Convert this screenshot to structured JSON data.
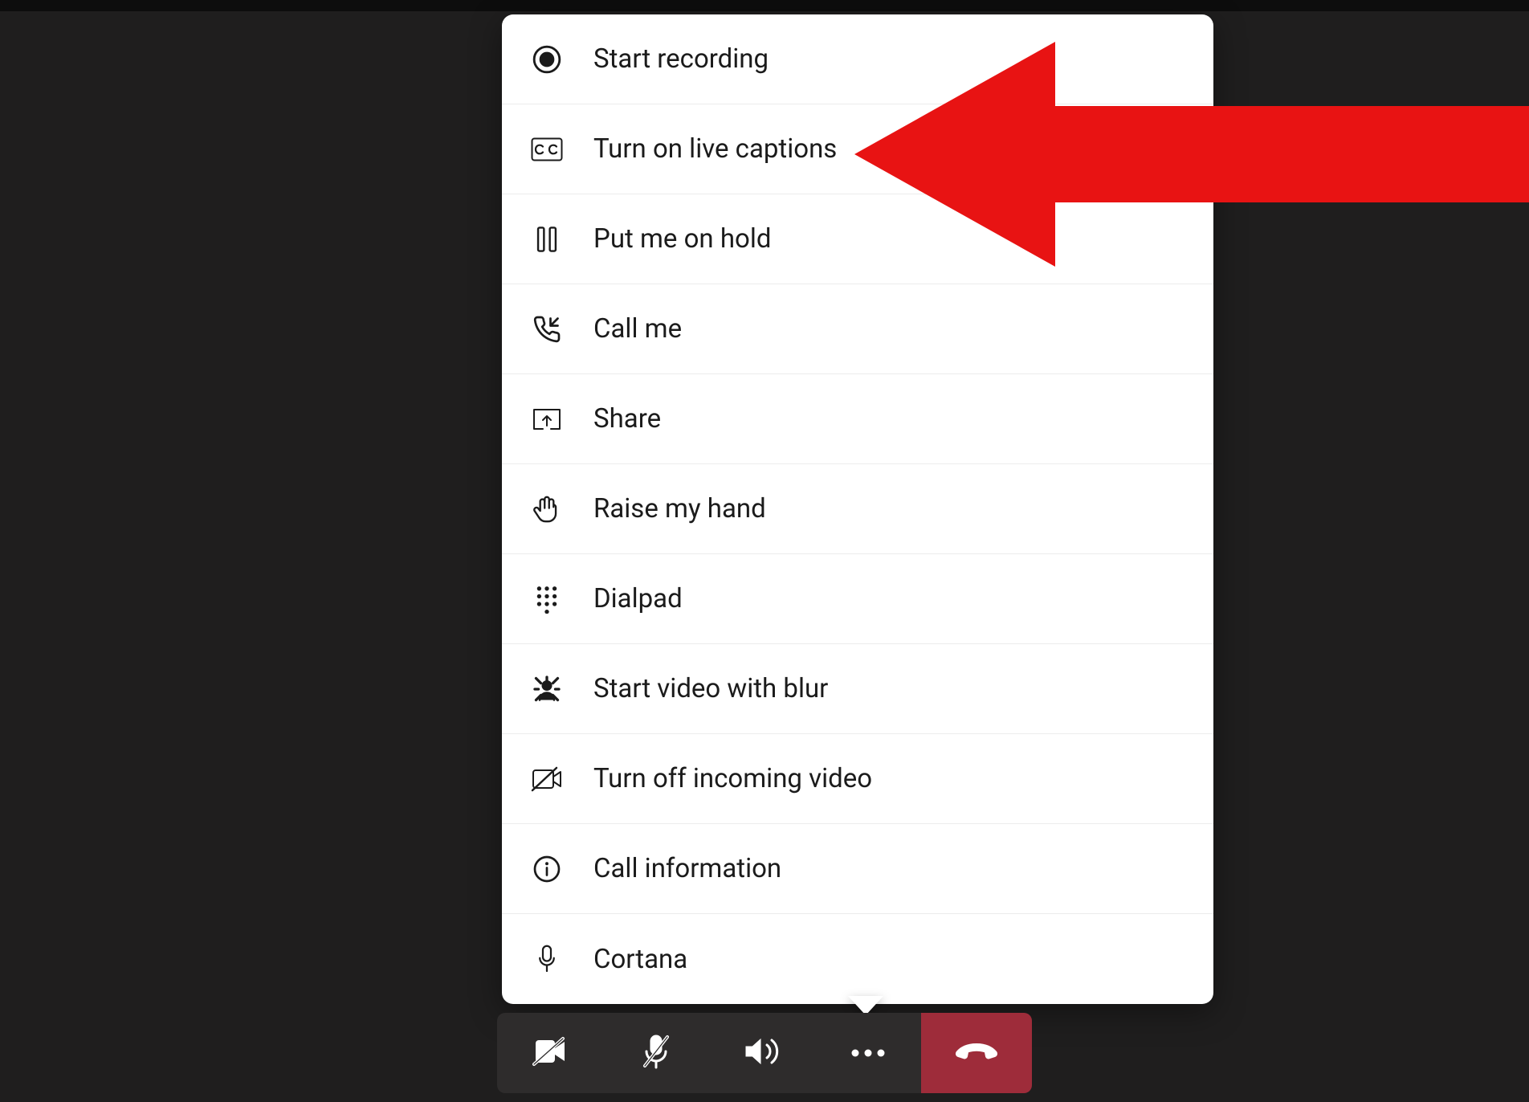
{
  "menu": {
    "items": [
      {
        "label": "Start recording",
        "icon": "record-icon"
      },
      {
        "label": "Turn on live captions",
        "icon": "cc-icon"
      },
      {
        "label": "Put me on hold",
        "icon": "pause-icon"
      },
      {
        "label": "Call me",
        "icon": "call-in-icon"
      },
      {
        "label": "Share",
        "icon": "share-screen-icon"
      },
      {
        "label": "Raise my hand",
        "icon": "hand-icon"
      },
      {
        "label": "Dialpad",
        "icon": "dialpad-icon"
      },
      {
        "label": "Start video with blur",
        "icon": "blur-icon"
      },
      {
        "label": "Turn off incoming video",
        "icon": "video-off-icon"
      },
      {
        "label": "Call information",
        "icon": "info-icon"
      },
      {
        "label": "Cortana",
        "icon": "mic-icon"
      }
    ]
  },
  "toolbar": {
    "buttons": [
      {
        "name": "camera-off-button",
        "icon": "camera-off-icon"
      },
      {
        "name": "mic-off-button",
        "icon": "mic-off-icon"
      },
      {
        "name": "speaker-button",
        "icon": "speaker-icon"
      },
      {
        "name": "more-button",
        "icon": "more-icon"
      },
      {
        "name": "hangup-button",
        "icon": "hangup-icon"
      }
    ]
  },
  "annotation": {
    "arrow_color": "#e81313"
  }
}
